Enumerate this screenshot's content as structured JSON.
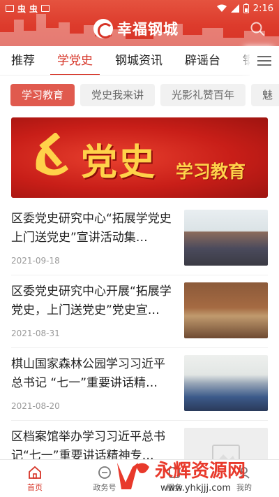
{
  "status_bar": {
    "left_glyphs": [
      "虫",
      "虫"
    ],
    "time": "2:16"
  },
  "brand": {
    "name": "幸福钢城"
  },
  "tabs": [
    {
      "label": "推荐",
      "active": false
    },
    {
      "label": "学党史",
      "active": true
    },
    {
      "label": "钢城资讯",
      "active": false
    },
    {
      "label": "辟谣台",
      "active": false
    },
    {
      "label": "钢",
      "active": false
    }
  ],
  "chips": [
    {
      "label": "学习教育",
      "active": true
    },
    {
      "label": "党史我来讲",
      "active": false
    },
    {
      "label": "光影礼赞百年",
      "active": false
    },
    {
      "label": "魅",
      "active": false
    }
  ],
  "banner": {
    "title": "党史",
    "subtitle": "学习教育"
  },
  "news": [
    {
      "title": "区委党史研究中心“拓展学党史 上门送党史”宣讲活动集…",
      "date": "2021-09-18"
    },
    {
      "title": "区委党史研究中心开展“拓展学党史，上门送党史”党史宣…",
      "date": "2021-08-31"
    },
    {
      "title": "棋山国家森林公园学习习近平总书记 “七一”重要讲话精…",
      "date": "2021-08-20"
    },
    {
      "title": "区档案馆举办学习习近平总书记“七一”重要讲话精神专…",
      "date": ""
    }
  ],
  "bottom_nav": [
    {
      "label": "首页",
      "icon": "home-icon",
      "active": true
    },
    {
      "label": "政务号",
      "icon": "gov-icon",
      "active": false
    },
    {
      "label": "服务",
      "icon": "service-icon",
      "active": false
    },
    {
      "label": "我的",
      "icon": "profile-icon",
      "active": false
    }
  ],
  "watermark": {
    "name": "永辉资源网",
    "url": "www.yhkjjj.com"
  },
  "colors": {
    "accent": "#d63326",
    "chip_active": "#e05a4e",
    "banner_text": "#ffd24a"
  }
}
